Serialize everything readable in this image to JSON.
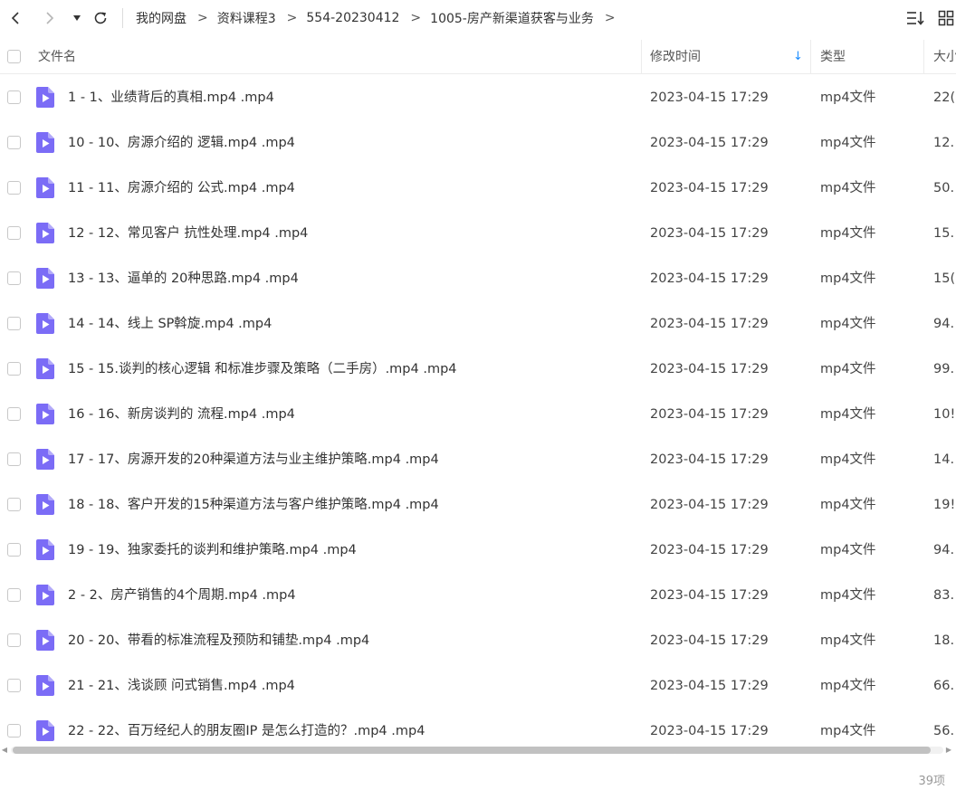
{
  "toolbar": {
    "back_icon": "chevron-left-icon",
    "forward_icon": "chevron-right-icon",
    "history_icon": "caret-down-icon",
    "refresh_icon": "refresh-icon",
    "sort_icon": "sort-list-icon",
    "grid_icon": "grid-view-icon"
  },
  "breadcrumb": {
    "items": [
      "我的网盘",
      "资料课程3",
      "554-20230412",
      "1005-房产新渠道获客与业务"
    ],
    "separator": ">"
  },
  "table": {
    "headers": {
      "name": "文件名",
      "modified": "修改时间",
      "type": "类型",
      "size": "大小"
    },
    "sort_indicator": "↓",
    "rows": [
      {
        "name": "1 - 1、业绩背后的真相.mp4 .mp4",
        "modified": "2023-04-15 17:29",
        "type": "mp4文件",
        "size": "22("
      },
      {
        "name": "10 - 10、房源介绍的 逻辑.mp4 .mp4",
        "modified": "2023-04-15 17:29",
        "type": "mp4文件",
        "size": "12."
      },
      {
        "name": "11 - 11、房源介绍的 公式.mp4 .mp4",
        "modified": "2023-04-15 17:29",
        "type": "mp4文件",
        "size": "50."
      },
      {
        "name": "12 - 12、常见客户 抗性处理.mp4 .mp4",
        "modified": "2023-04-15 17:29",
        "type": "mp4文件",
        "size": "15."
      },
      {
        "name": "13 - 13、逼单的 20种思路.mp4 .mp4",
        "modified": "2023-04-15 17:29",
        "type": "mp4文件",
        "size": "15("
      },
      {
        "name": "14 - 14、线上 SP斡旋.mp4 .mp4",
        "modified": "2023-04-15 17:29",
        "type": "mp4文件",
        "size": "94."
      },
      {
        "name": "15 - 15.谈判的核心逻辑 和标准步骤及策略（二手房）.mp4 .mp4",
        "modified": "2023-04-15 17:29",
        "type": "mp4文件",
        "size": "99."
      },
      {
        "name": "16 - 16、新房谈判的 流程.mp4 .mp4",
        "modified": "2023-04-15 17:29",
        "type": "mp4文件",
        "size": "10!"
      },
      {
        "name": "17 - 17、房源开发的20种渠道方法与业主维护策略.mp4 .mp4",
        "modified": "2023-04-15 17:29",
        "type": "mp4文件",
        "size": "14."
      },
      {
        "name": "18 - 18、客户开发的15种渠道方法与客户维护策略.mp4 .mp4",
        "modified": "2023-04-15 17:29",
        "type": "mp4文件",
        "size": "19!"
      },
      {
        "name": "19 - 19、独家委托的谈判和维护策略.mp4 .mp4",
        "modified": "2023-04-15 17:29",
        "type": "mp4文件",
        "size": "94."
      },
      {
        "name": "2 - 2、房产销售的4个周期.mp4 .mp4",
        "modified": "2023-04-15 17:29",
        "type": "mp4文件",
        "size": "83."
      },
      {
        "name": "20 - 20、带看的标准流程及预防和铺垫.mp4 .mp4",
        "modified": "2023-04-15 17:29",
        "type": "mp4文件",
        "size": "18."
      },
      {
        "name": "21 - 21、浅谈顾 问式销售.mp4 .mp4",
        "modified": "2023-04-15 17:29",
        "type": "mp4文件",
        "size": "66."
      },
      {
        "name": "22 - 22、百万经纪人的朋友圈IP 是怎么打造的？.mp4 .mp4",
        "modified": "2023-04-15 17:29",
        "type": "mp4文件",
        "size": "56."
      }
    ],
    "file_icon": "video-file-icon"
  },
  "status": {
    "count": "39项"
  },
  "colors": {
    "accent": "#1a8cff",
    "file_icon": "#7b6cf6",
    "border": "#ececec"
  }
}
